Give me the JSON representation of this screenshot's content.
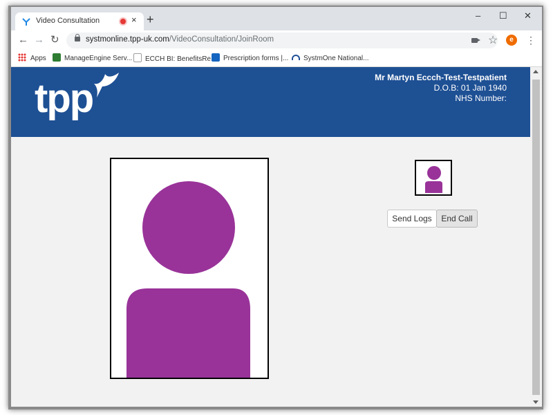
{
  "browser": {
    "tab_title": "Video Consultation",
    "tab_close": "×",
    "new_tab": "+",
    "url_host": "systmonline.tpp-uk.com",
    "url_path": "/VideoConsultation/JoinRoom",
    "profile_initial": "e",
    "window_controls": {
      "minimize": "–",
      "maximize": "☐",
      "close": "✕"
    },
    "nav": {
      "back": "←",
      "forward": "→",
      "reload": "↻"
    },
    "star": "☆",
    "menu": "⋮",
    "icons": [
      "recording-dot-icon",
      "lock-icon",
      "camera-icon",
      "star-icon",
      "kebab-menu-icon"
    ]
  },
  "bookmarks": [
    {
      "label": "Apps",
      "icon": "apps-grid-icon"
    },
    {
      "label": "ManageEngine Serv...",
      "icon": "manageengine-icon",
      "color": "#2e7d32"
    },
    {
      "label": "ECCH BI: BenefitsRe...",
      "icon": "document-icon",
      "color": "#9e9e9e"
    },
    {
      "label": "Prescription forms |...",
      "icon": "nhs-bsa-icon",
      "color": "#1565c0"
    },
    {
      "label": "SystmOne National...",
      "icon": "systmone-icon",
      "color": "#1e5094"
    }
  ],
  "header": {
    "logo": "tpp",
    "patient_name": "Mr Martyn Eccch-Test-Testpatient",
    "dob": "D.O.B: 01 Jan 1940",
    "nhs_number": "NHS Number:"
  },
  "call": {
    "send_logs_label": "Send Logs",
    "end_call_label": "End Call"
  },
  "colors": {
    "banner": "#1e5094",
    "avatar": "#993399"
  }
}
